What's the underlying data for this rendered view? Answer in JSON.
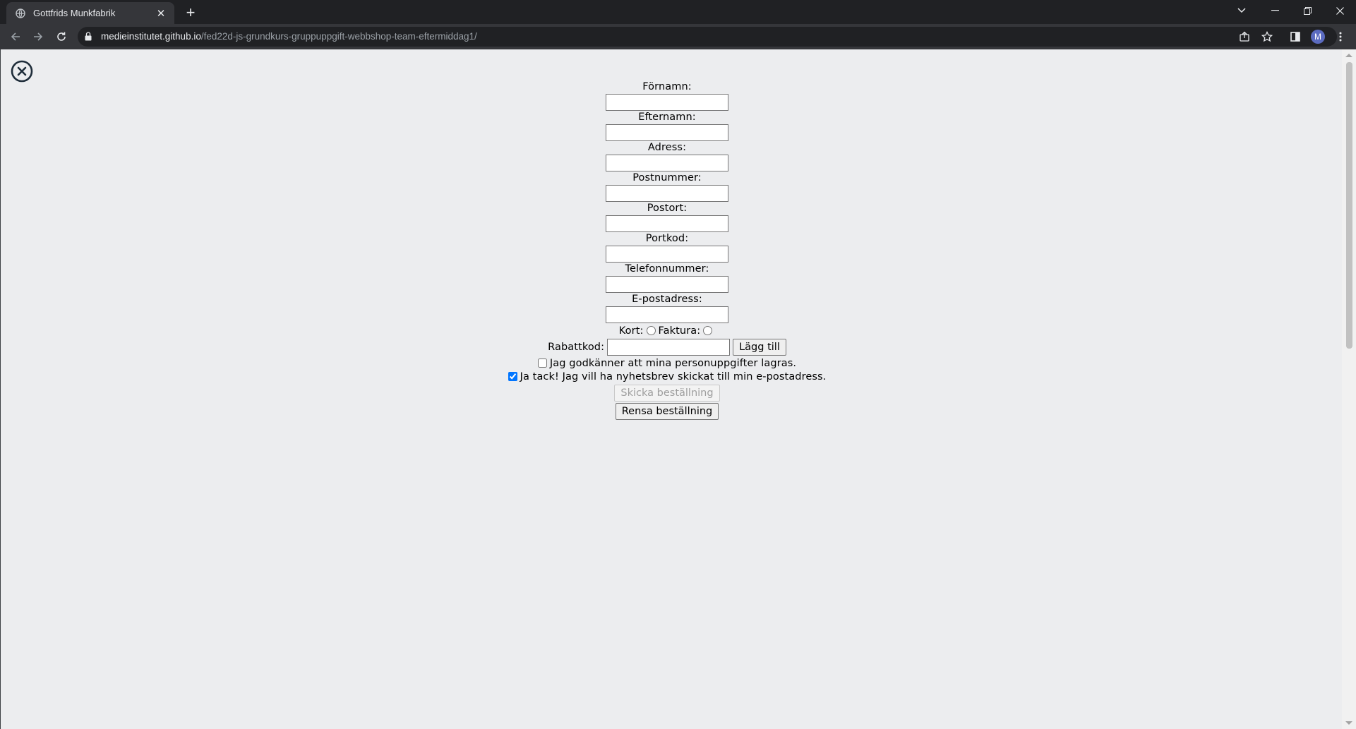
{
  "browser": {
    "tab_title": "Gottfrids Munkfabrik",
    "url_host": "medieinstitutet.github.io",
    "url_path": "/fed22d-js-grundkurs-gruppuppgift-webbshop-team-eftermiddag1/",
    "avatar_letter": "M"
  },
  "form": {
    "fields": [
      {
        "label": "Förnamn:",
        "value": ""
      },
      {
        "label": "Efternamn:",
        "value": ""
      },
      {
        "label": "Adress:",
        "value": ""
      },
      {
        "label": "Postnummer:",
        "value": ""
      },
      {
        "label": "Postort:",
        "value": ""
      },
      {
        "label": "Portkod:",
        "value": ""
      },
      {
        "label": "Telefonnummer:",
        "value": ""
      },
      {
        "label": "E-postadress:",
        "value": ""
      }
    ],
    "payment": {
      "card_label": "Kort:",
      "invoice_label": "Faktura:"
    },
    "discount": {
      "label": "Rabattkod:",
      "value": "",
      "button_label": "Lägg till"
    },
    "consent_label": "Jag godkänner att mina personuppgifter lagras.",
    "consent_checked": false,
    "newsletter_label": "Ja tack! Jag vill ha nyhetsbrev skickat till min e-postadress.",
    "newsletter_checked": true,
    "submit_label": "Skicka beställning",
    "reset_label": "Rensa beställning"
  }
}
